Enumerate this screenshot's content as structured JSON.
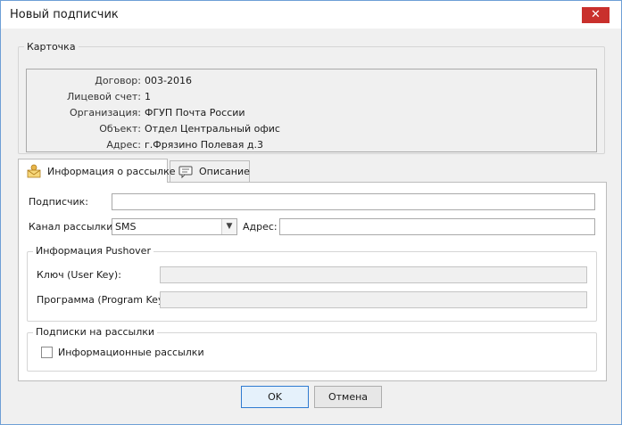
{
  "window": {
    "title": "Новый подписчик",
    "close_glyph": "✕"
  },
  "card": {
    "legend": "Карточка",
    "rows": [
      {
        "label": "Договор:",
        "value": "003-2016"
      },
      {
        "label": "Лицевой счет:",
        "value": "1"
      },
      {
        "label": "Организация:",
        "value": "ФГУП Почта России"
      },
      {
        "label": "Объект:",
        "value": "Отдел Центральный офис"
      },
      {
        "label": "Адрес:",
        "value": "г.Фрязино Полевая д.3"
      }
    ]
  },
  "tabs": [
    {
      "label": "Информация о рассылке",
      "icon": "envelope-icon",
      "active": true
    },
    {
      "label": "Описание",
      "icon": "comment-icon",
      "active": false
    }
  ],
  "form": {
    "subscriber_label": "Подписчик:",
    "subscriber_value": "",
    "channel_label": "Канал рассылки:",
    "channel_value": "SMS",
    "address_label": "Адрес:",
    "address_value": ""
  },
  "pushover": {
    "legend": "Информация Pushover",
    "user_key_label": "Ключ (User Key):",
    "user_key_value": "",
    "program_key_label": "Программа (Program Key):",
    "program_key_value": ""
  },
  "subscriptions": {
    "legend": "Подписки на рассылки",
    "items": [
      {
        "label": "Информационные рассылки",
        "checked": false
      }
    ]
  },
  "buttons": {
    "ok": "OK",
    "cancel": "Отмена"
  },
  "colors": {
    "accent": "#2f7bd1",
    "close": "#c9302c"
  }
}
